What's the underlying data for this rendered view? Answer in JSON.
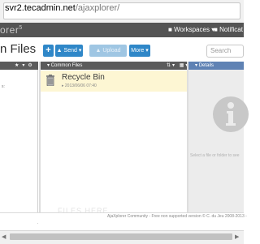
{
  "browser": {
    "url_host": "svr2.tecadmin.net",
    "url_path": "/ajaxplorer/"
  },
  "app": {
    "brand": "orer",
    "brand_sup": "5",
    "menu_workspaces": "Workspaces",
    "menu_notifications": "Notificat"
  },
  "toolbar": {
    "title": "n Files",
    "add_label": "+",
    "send_label": "Send",
    "upload_label": "Upload",
    "more_label": "More",
    "search_placeholder": "Search"
  },
  "main": {
    "header_label": "Common Files",
    "files": [
      {
        "name": "Recycle Bin",
        "meta": "2013/06/06 07:40",
        "icon": "recycle-bin-icon"
      }
    ],
    "watermark": "FILES HERE"
  },
  "details": {
    "header_label": "Details",
    "hint": "Select a file or folder to see",
    "icon": "info-icon"
  },
  "left_panel": {
    "text": "s:"
  },
  "footer": {
    "text": "AjaXplorer Community - Free non supported version © C. du Jeu 2008-2013 -"
  },
  "colors": {
    "header_bg": "#545454",
    "button_blue": "#2f87c8",
    "details_head": "#5f82b4",
    "selected_row": "#fdf6d3"
  }
}
